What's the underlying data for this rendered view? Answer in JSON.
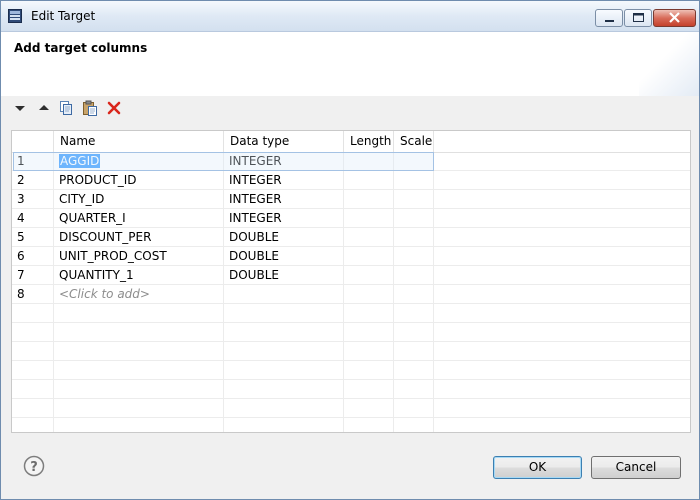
{
  "window": {
    "title": "Edit Target",
    "controls": {
      "minimize": "minimize-icon",
      "maximize": "maximize-icon",
      "close": "close-icon"
    }
  },
  "header": {
    "title": "Add target columns"
  },
  "toolbar": {
    "items": [
      "move-down-icon",
      "move-up-icon",
      "copy-icon",
      "paste-icon",
      "delete-icon"
    ]
  },
  "table": {
    "columns": [
      "",
      "Name",
      "Data type",
      "Length",
      "Scale"
    ],
    "rows": [
      {
        "num": "1",
        "name": "AGGID",
        "type": "INTEGER",
        "length": "",
        "scale": ""
      },
      {
        "num": "2",
        "name": "PRODUCT_ID",
        "type": "INTEGER",
        "length": "",
        "scale": ""
      },
      {
        "num": "3",
        "name": "CITY_ID",
        "type": "INTEGER",
        "length": "",
        "scale": ""
      },
      {
        "num": "4",
        "name": "QUARTER_I",
        "type": "INTEGER",
        "length": "",
        "scale": ""
      },
      {
        "num": "5",
        "name": "DISCOUNT_PER",
        "type": "DOUBLE",
        "length": "",
        "scale": ""
      },
      {
        "num": "6",
        "name": "UNIT_PROD_COST",
        "type": "DOUBLE",
        "length": "",
        "scale": ""
      },
      {
        "num": "7",
        "name": "QUANTITY_1",
        "type": "DOUBLE",
        "length": "",
        "scale": ""
      },
      {
        "num": "8",
        "name": "<Click to add>",
        "type": "",
        "length": "",
        "scale": ""
      }
    ]
  },
  "buttons": {
    "ok": "OK",
    "cancel": "Cancel"
  },
  "colors": {
    "selection": "#3399ff",
    "delete": "#d9261c",
    "accent": "#3c7fb1"
  }
}
